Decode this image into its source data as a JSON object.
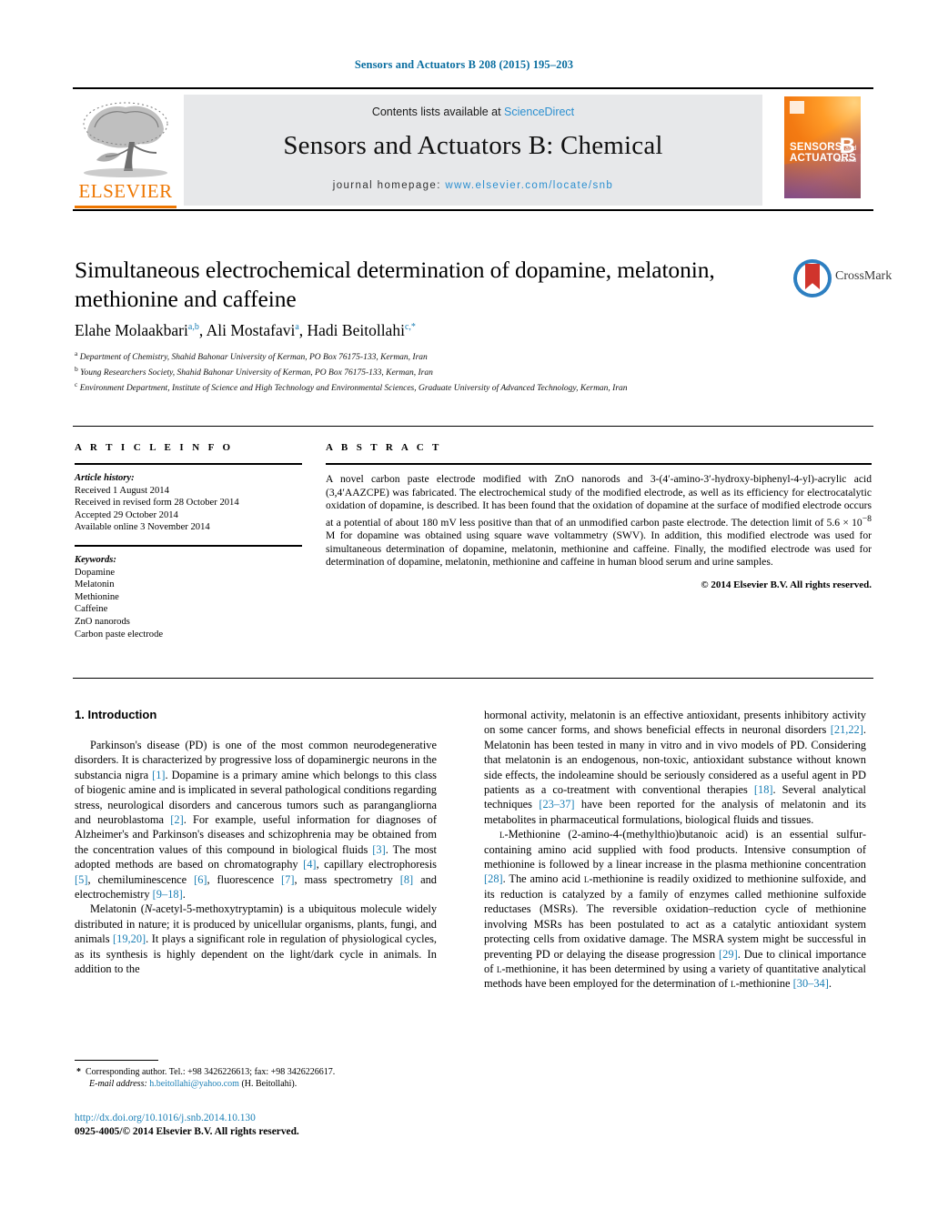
{
  "running_head": "Sensors and Actuators B 208 (2015) 195–203",
  "masthead": {
    "contents_prefix": "Contents lists available at ",
    "sciencedirect": "ScienceDirect",
    "journal_title": "Sensors and Actuators B: Chemical",
    "homepage_label": "journal homepage:",
    "homepage_url": "www.elsevier.com/locate/snb",
    "publisher_logo_text": "ELSEVIER",
    "cover": {
      "line1": "SENSORS",
      "line1_small": "and",
      "line2": "ACTUATORS",
      "volume_letter": "B",
      "sub_letter": "Chemical"
    },
    "accent_blue": "#2b8fd0"
  },
  "article": {
    "title": "Simultaneous electrochemical determination of dopamine, melatonin, methionine and caffeine",
    "authors_html": "Elahe Molaakbari<sup>a,b</sup>, Ali Mostafavi<sup>a</sup>, Hadi Beitollahi<sup>c,*</sup>",
    "affiliations": [
      {
        "marker": "a",
        "text": "Department of Chemistry, Shahid Bahonar University of Kerman, PO Box 76175-133, Kerman, Iran"
      },
      {
        "marker": "b",
        "text": "Young Researchers Society, Shahid Bahonar University of Kerman, PO Box 76175-133, Kerman, Iran"
      },
      {
        "marker": "c",
        "text": "Environment Department, Institute of Science and High Technology and Environmental Sciences, Graduate University of Advanced Technology, Kerman, Iran"
      }
    ],
    "crossmark_label": "CrossMark"
  },
  "article_info": {
    "heading": "A R T I C L E  I N F O",
    "history_label": "Article history:",
    "history": [
      "Received 1 August 2014",
      "Received in revised form 28 October 2014",
      "Accepted 29 October 2014",
      "Available online 3 November 2014"
    ],
    "keywords_label": "Keywords:",
    "keywords": [
      "Dopamine",
      "Melatonin",
      "Methionine",
      "Caffeine",
      "ZnO nanorods",
      "Carbon paste electrode"
    ]
  },
  "abstract": {
    "heading": "A B S T R A C T",
    "text_html": "A novel carbon paste electrode modified with ZnO nanorods and 3-(4&prime;-amino-3&prime;-hydroxy-biphenyl-4-yl)-acrylic acid (3,4&prime;AAZCPE) was fabricated. The electrochemical study of the modified electrode, as well as its efficiency for electrocatalytic oxidation of dopamine, is described. It has been found that the oxidation of dopamine at the surface of modified electrode occurs at a potential of about 180 mV less positive than that of an unmodified carbon paste electrode. The detection limit of 5.6 &times; 10<sup>&minus;8</sup> M for dopamine was obtained using square wave voltammetry (SWV). In addition, this modified electrode was used for simultaneous determination of dopamine, melatonin, methionine and caffeine. Finally, the modified electrode was used for determination of dopamine, melatonin, methionine and caffeine in human blood serum and urine samples.",
    "copyright": "© 2014 Elsevier B.V. All rights reserved."
  },
  "body": {
    "section_number_title": "1.  Introduction",
    "left_paragraphs_html": [
      "Parkinson's disease (PD) is one of the most common neurodegenerative disorders. It is characterized by progressive loss of dopaminergic neurons in the substancia nigra <span class=\"ref\">[1]</span>. Dopamine is a primary amine which belongs to this class of biogenic amine and is implicated in several pathological conditions regarding stress, neurological disorders and cancerous tumors such as parangangliorna and neuroblastoma <span class=\"ref\">[2]</span>. For example, useful information for diagnoses of Alzheimer's and Parkinson's diseases and schizophrenia may be obtained from the concentration values of this compound in biological fluids <span class=\"ref\">[3]</span>. The most adopted methods are based on chromatography <span class=\"ref\">[4]</span>, capillary electrophoresis <span class=\"ref\">[5]</span>, chemiluminescence <span class=\"ref\">[6]</span>, fluorescence <span class=\"ref\">[7]</span>, mass spectrometry <span class=\"ref\">[8]</span> and electrochemistry <span class=\"ref\">[9–18]</span>.",
      "Melatonin (<i>N</i>-acetyl-5-methoxytryptamin) is a ubiquitous molecule widely distributed in nature; it is produced by unicellular organisms, plants, fungi, and animals <span class=\"ref\">[19,20]</span>. It plays a significant role in regulation of physiological cycles, as its synthesis is highly dependent on the light/dark cycle in animals. In addition to the"
    ],
    "right_paragraphs_html": [
      "hormonal activity, melatonin is an effective antioxidant, presents inhibitory activity on some cancer forms, and shows beneficial effects in neuronal disorders <span class=\"ref\">[21,22]</span>. Melatonin has been tested in many in vitro and in vivo models of PD. Considering that melatonin is an endogenous, non-toxic, antioxidant substance without known side effects, the indoleamine should be seriously considered as a useful agent in PD patients as a co-treatment with conventional therapies <span class=\"ref\">[18]</span>. Several analytical techniques <span class=\"ref\">[23–37]</span> have been reported for the analysis of melatonin and its metabolites in pharmaceutical formulations, biological fluids and tissues.",
      "<span class=\"sc\">l</span>-Methionine (2-amino-4-(methylthio)butanoic acid) is an essential sulfur-containing amino acid supplied with food products. Intensive consumption of methionine is followed by a linear increase in the plasma methionine concentration <span class=\"ref\">[28]</span>. The amino acid <span class=\"sc\">l</span>-methionine is readily oxidized to methionine sulfoxide, and its reduction is catalyzed by a family of enzymes called methionine sulfoxide reductases (MSRs). The reversible oxidation–reduction cycle of methionine involving MSRs has been postulated to act as a catalytic antioxidant system protecting cells from oxidative damage. The MSRA system might be successful in preventing PD or delaying the disease progression <span class=\"ref\">[29]</span>. Due to clinical importance of <span class=\"sc\">l</span>-methionine, it has been determined by using a variety of quantitative analytical methods have been employed for the determination of <span class=\"sc\">l</span>-methionine <span class=\"ref\">[30–34]</span>."
    ]
  },
  "footer": {
    "corresponding_html": "<b>*</b>&nbsp; Corresponding author. Tel.: +98 3426226613; fax: +98 3426226617.",
    "email_label": "E-mail address:",
    "email": "h.beitollahi@yahoo.com",
    "email_owner": "(H. Beitollahi).",
    "doi_url": "http://dx.doi.org/10.1016/j.snb.2014.10.130",
    "issn_line": "0925-4005/© 2014 Elsevier B.V. All rights reserved."
  }
}
